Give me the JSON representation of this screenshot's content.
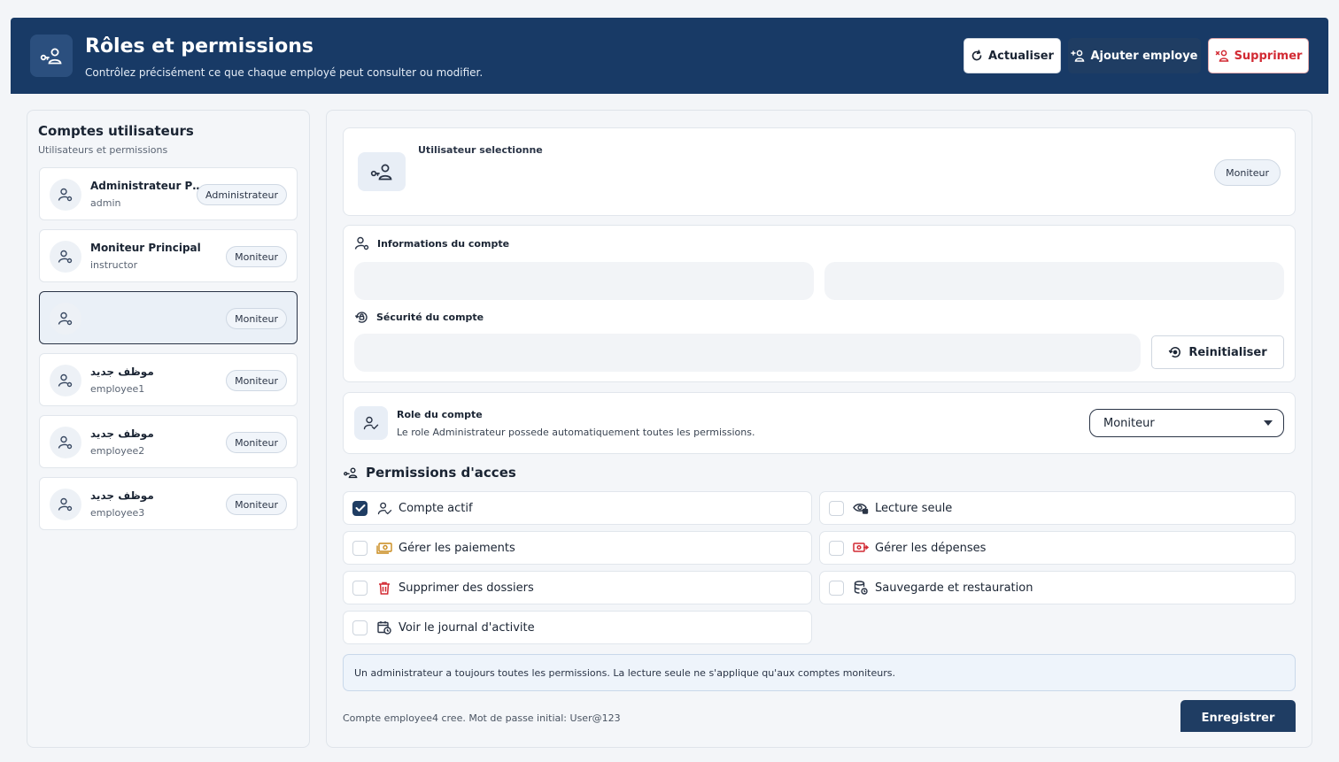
{
  "header": {
    "title": "Rôles et permissions",
    "subtitle": "Contrôlez précisément ce que chaque employé peut consulter ou modifier.",
    "refresh_label": "Actualiser",
    "add_label": "Ajouter employe",
    "delete_label": "Supprimer"
  },
  "users_panel": {
    "title": "Comptes utilisateurs",
    "subtitle": "Utilisateurs et permissions",
    "users": [
      {
        "name": "Administrateur Permissions",
        "login": "admin",
        "role": "Administrateur"
      },
      {
        "name": "Moniteur Principal",
        "login": "instructor",
        "role": "Moniteur"
      },
      {
        "name": "",
        "login": "",
        "role": "Moniteur"
      },
      {
        "name": "موظف جديد",
        "login": "employee1",
        "role": "Moniteur"
      },
      {
        "name": "موظف جديد",
        "login": "employee2",
        "role": "Moniteur"
      },
      {
        "name": "موظف جديد",
        "login": "employee3",
        "role": "Moniteur"
      }
    ]
  },
  "selected_user": {
    "label": "Utilisateur selectionne",
    "role": "Moniteur"
  },
  "account_info": {
    "title": "Informations du compte",
    "field1_value": "",
    "field2_value": "",
    "security_title": "Sécurité du compte",
    "password_value": "",
    "reset_label": "Reinitialiser"
  },
  "role_section": {
    "title": "Role du compte",
    "description": "Le role Administrateur possede automatiquement toutes les permissions.",
    "selected": "Moniteur"
  },
  "permissions": {
    "title": "Permissions d'acces",
    "items": [
      {
        "label": "Compte actif",
        "checked": true,
        "icon": "user-check-icon"
      },
      {
        "label": "Lecture seule",
        "checked": false,
        "icon": "eye-lock-icon"
      },
      {
        "label": "Gérer les paiements",
        "checked": false,
        "icon": "money-icon"
      },
      {
        "label": "Gérer les dépenses",
        "checked": false,
        "icon": "expense-icon"
      },
      {
        "label": "Supprimer des dossiers",
        "checked": false,
        "icon": "trash-icon"
      },
      {
        "label": "Sauvegarde et restauration",
        "checked": false,
        "icon": "database-icon"
      },
      {
        "label": "Voir le journal d'activite",
        "checked": false,
        "icon": "calendar-clock-icon"
      }
    ]
  },
  "footer": {
    "note": "Un administrateur a toujours toutes les permissions. La lecture seule ne s'applique qu'aux comptes moniteurs.",
    "status": "Compte employee4 cree. Mot de passe initial: User@123",
    "save_label": "Enregistrer"
  },
  "colors": {
    "header_bg": "#183a66",
    "primary": "#1f3d63",
    "danger": "#d22a33"
  }
}
